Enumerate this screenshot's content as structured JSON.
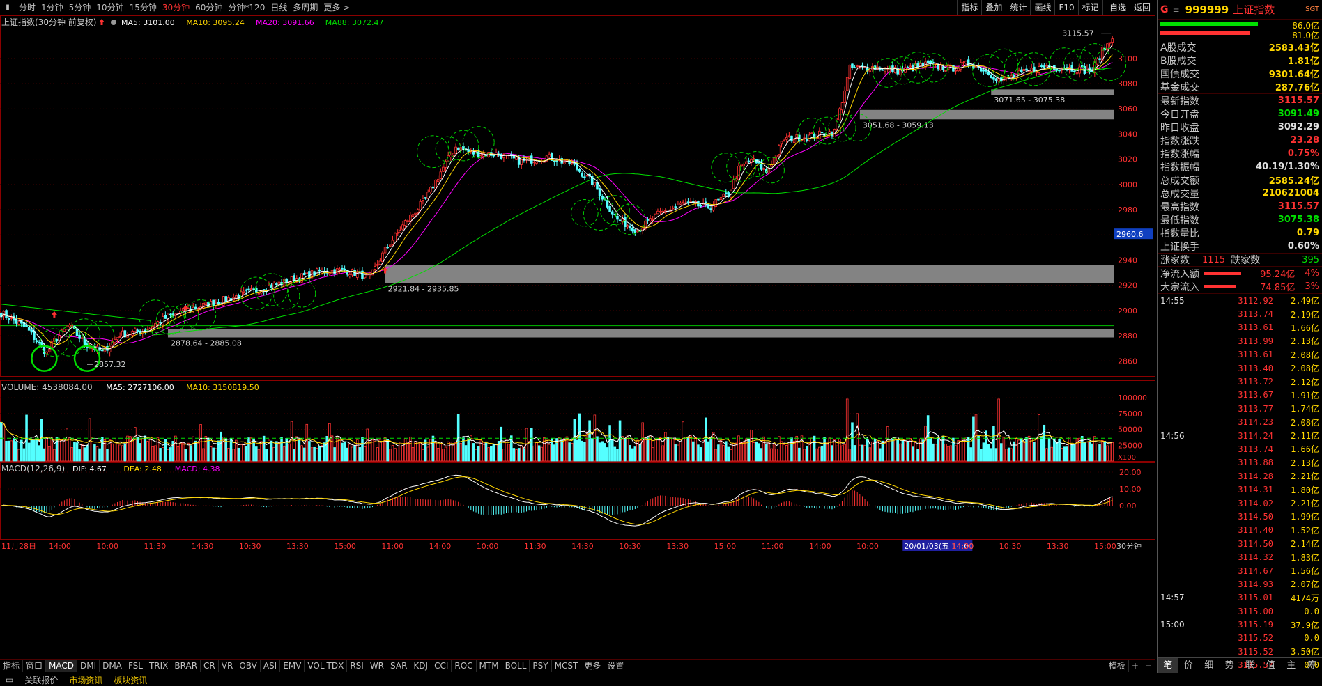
{
  "toolbar": {
    "periods": [
      "分时",
      "1分钟",
      "5分钟",
      "10分钟",
      "15分钟",
      "30分钟",
      "60分钟",
      "分钟*120",
      "日线",
      "多周期",
      "更多 >"
    ],
    "active_period": "30分钟",
    "tools": [
      "指标",
      "叠加",
      "统计",
      "画线",
      "F10",
      "标记",
      "-自选",
      "返回"
    ]
  },
  "main": {
    "title": "上证指数(30分钟 前复权)",
    "ma": [
      {
        "label": "MA5: 3101.00",
        "color": "#ffffff"
      },
      {
        "label": "MA10: 3095.24",
        "color": "#ffd700"
      },
      {
        "label": "MA20: 3091.66",
        "color": "#ff00ff"
      },
      {
        "label": "MA88: 3072.47",
        "color": "#00e000"
      }
    ],
    "y_ticks": [
      2860,
      2880,
      2900,
      2920,
      2940,
      2960,
      2980,
      3000,
      3020,
      3040,
      3060,
      3080,
      3100
    ],
    "ymin": 2848,
    "ymax": 3122,
    "cursor_label": "2960.6",
    "high_label": "3115.57",
    "low_label": "2857.32",
    "zones": [
      "3071.65 - 3075.38",
      "3051.68 - 3059.13",
      "2921.84 - 2935.85",
      "2878.64 - 2885.08"
    ],
    "hline": 2888
  },
  "volume": {
    "title": "VOLUME: 4538084.00",
    "ma": [
      {
        "label": "MA5: 2727106.00",
        "color": "#ffffff"
      },
      {
        "label": "MA10: 3150819.50",
        "color": "#ffd700"
      }
    ],
    "y_ticks": [
      25000,
      50000,
      75000,
      100000
    ],
    "unit": "X100"
  },
  "macd": {
    "title": "MACD(12,26,9)",
    "lines": [
      {
        "label": "DIF: 4.67",
        "color": "#ffffff"
      },
      {
        "label": "DEA: 2.48",
        "color": "#ffd700"
      },
      {
        "label": "MACD: 4.38",
        "color": "#ff00ff"
      }
    ],
    "y_ticks": [
      "20.00",
      "10.00",
      "0.00"
    ]
  },
  "xaxis": {
    "labels": [
      "11月28日",
      "14:00",
      "10:00",
      "11:30",
      "14:30",
      "10:30",
      "13:30",
      "15:00",
      "11:00",
      "14:00",
      "10:00",
      "11:30",
      "14:30",
      "10:30",
      "13:30",
      "15:00",
      "11:00",
      "14:00",
      "10:00",
      "20/01/03(五 14:00",
      "14:30",
      "10:30",
      "13:30",
      "15:00"
    ],
    "period": "30分钟"
  },
  "indicator_tabs": [
    "指标",
    "窗口",
    "MACD",
    "DMI",
    "DMA",
    "FSL",
    "TRIX",
    "BRAR",
    "CR",
    "VR",
    "OBV",
    "ASI",
    "EMV",
    "VOL-TDX",
    "RSI",
    "WR",
    "SAR",
    "KDJ",
    "CCI",
    "ROC",
    "MTM",
    "BOLL",
    "PSY",
    "MCST",
    "更多",
    "设置"
  ],
  "indicator_active": "MACD",
  "bottom_right": [
    "模板",
    "+",
    "−"
  ],
  "statusbar": [
    "关联报价",
    "市场资讯",
    "板块资讯"
  ],
  "panel": {
    "code": "999999",
    "name": "上证指数",
    "tag": "SGT",
    "group": "G",
    "wb_pct": [
      "86.0亿",
      "81.0亿"
    ],
    "turnover": [
      [
        "A股成交",
        "2583.43亿",
        "#ffd700"
      ],
      [
        "B股成交",
        "1.81亿",
        "#ffd700"
      ],
      [
        "国债成交",
        "9301.64亿",
        "#ffd700"
      ],
      [
        "基金成交",
        "287.76亿",
        "#ffd700"
      ]
    ],
    "stats": [
      [
        "最新指数",
        "3115.57",
        "#ff3232"
      ],
      [
        "今日开盘",
        "3091.49",
        "#00e000"
      ],
      [
        "昨日收盘",
        "3092.29",
        "#e0e0e0"
      ],
      [
        "指数涨跌",
        "23.28",
        "#ff3232"
      ],
      [
        "指数涨幅",
        "0.75%",
        "#ff3232"
      ],
      [
        "指数振幅",
        "40.19/1.30%",
        "#e0e0e0"
      ],
      [
        "总成交额",
        "2585.24亿",
        "#ffd700"
      ],
      [
        "总成交量",
        "210621004",
        "#ffd700"
      ],
      [
        "最高指数",
        "3115.57",
        "#ff3232"
      ],
      [
        "最低指数",
        "3075.38",
        "#00e000"
      ],
      [
        "指数量比",
        "0.79",
        "#ffd700"
      ],
      [
        "上证换手",
        "0.60%",
        "#e0e0e0"
      ]
    ],
    "breadth": {
      "up_label": "涨家数",
      "up": "1115",
      "down_label": "跌家数",
      "down": "395"
    },
    "flows": [
      [
        "净流入额",
        "95.24亿",
        "4%"
      ],
      [
        "大宗流入",
        "74.85亿",
        "3%"
      ]
    ],
    "ticks": [
      [
        "14:55",
        "3112.92",
        "2.49亿"
      ],
      [
        "",
        "3113.74",
        "2.19亿"
      ],
      [
        "",
        "3113.61",
        "1.66亿"
      ],
      [
        "",
        "3113.99",
        "2.13亿"
      ],
      [
        "",
        "3113.61",
        "2.08亿"
      ],
      [
        "",
        "3113.40",
        "2.08亿"
      ],
      [
        "",
        "3113.72",
        "2.12亿"
      ],
      [
        "",
        "3113.67",
        "1.91亿"
      ],
      [
        "",
        "3113.77",
        "1.74亿"
      ],
      [
        "",
        "3114.23",
        "2.08亿"
      ],
      [
        "14:56",
        "3114.24",
        "2.11亿"
      ],
      [
        "",
        "3113.74",
        "1.66亿"
      ],
      [
        "",
        "3113.88",
        "2.13亿"
      ],
      [
        "",
        "3114.28",
        "2.21亿"
      ],
      [
        "",
        "3114.31",
        "1.80亿"
      ],
      [
        "",
        "3114.02",
        "2.21亿"
      ],
      [
        "",
        "3114.50",
        "1.99亿"
      ],
      [
        "",
        "3114.40",
        "1.52亿"
      ],
      [
        "",
        "3114.50",
        "2.14亿"
      ],
      [
        "",
        "3114.32",
        "1.83亿"
      ],
      [
        "",
        "3114.67",
        "1.56亿"
      ],
      [
        "",
        "3114.93",
        "2.07亿"
      ],
      [
        "14:57",
        "3115.01",
        "4174万"
      ],
      [
        "",
        "3115.00",
        "0.0"
      ],
      [
        "15:00",
        "3115.19",
        "37.9亿"
      ],
      [
        "",
        "3115.52",
        "0.0"
      ],
      [
        "",
        "3115.52",
        "3.50亿"
      ],
      [
        "",
        "3115.57",
        "0.0"
      ]
    ],
    "tabs": [
      "笔",
      "价",
      "细",
      "势",
      "联",
      "值",
      "主",
      "筹"
    ],
    "active_tab": "笔"
  }
}
